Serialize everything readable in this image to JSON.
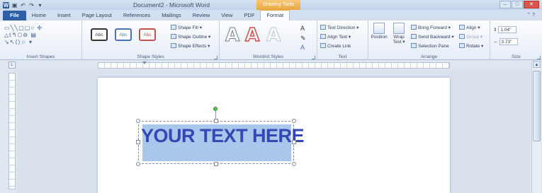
{
  "window": {
    "title": "Document2 - Microsoft Word",
    "contextual_tab_group": "Drawing Tools",
    "minimize": "–",
    "maximize": "□",
    "close": "✕"
  },
  "quick_access": {
    "word": "W",
    "save": "▣",
    "undo": "↶",
    "redo": "↷",
    "customize": "▾"
  },
  "tabs": [
    "File",
    "Home",
    "Insert",
    "Page Layout",
    "References",
    "Mailings",
    "Review",
    "View",
    "PDF",
    "Format"
  ],
  "help": "⌃ ?",
  "ribbon": {
    "insert_shapes": {
      "label": "Insert Shapes",
      "shapes_row1": "▭╲╲▢▢○ ✣",
      "shapes_row2": "△ℓ↰⬡⊖ ▤",
      "shapes_row3": "↘↖⟨⟩☆ ▾"
    },
    "shape_styles": {
      "label": "Shape Styles",
      "styles": [
        "Abc",
        "Abc",
        "Abc"
      ],
      "fill": "Shape Fill ▾",
      "outline": "Shape Outline ▾",
      "effects": "Shape Effects ▾"
    },
    "wordart_styles": {
      "label": "WordArt Styles",
      "letters": [
        "A",
        "A",
        "A"
      ]
    },
    "text": {
      "label": "Text",
      "direction": "Text Direction ▾",
      "align": "Align Text ▾",
      "link": "Create Link"
    },
    "arrange": {
      "label": "Arrange",
      "position": "Position",
      "wrap": "Wrap Text ▾",
      "bring_forward": "Bring Forward ▾",
      "send_backward": "Send Backward ▾",
      "selection_pane": "Selection Pane",
      "align": "Align ▾",
      "group": "Group ▾",
      "rotate": "Rotate ▾"
    },
    "size": {
      "label": "Size",
      "height": "1.04\"",
      "width": "3.73\""
    }
  },
  "document": {
    "wordart_text": "YOUR TEXT HERE"
  },
  "colors": {
    "file_tab": "#2d5fa7",
    "drawing_tools": "#e9a640",
    "wordart_fill": "#3447b6",
    "textbox_fill": "#a9c7ea"
  }
}
